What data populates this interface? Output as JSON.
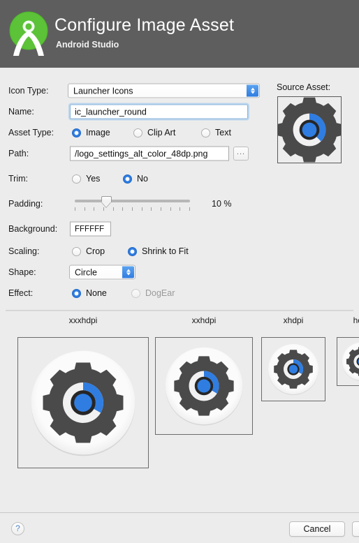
{
  "header": {
    "title": "Configure Image Asset",
    "subtitle": "Android Studio",
    "logo_icon": "android-studio-logo",
    "bg_color": "#5E5E5E"
  },
  "form": {
    "icon_type": {
      "label": "Icon Type:",
      "value": "Launcher Icons",
      "control": "combo-box"
    },
    "name": {
      "label": "Name:",
      "value": "ic_launcher_round",
      "focused": true
    },
    "asset_type": {
      "label": "Asset Type:",
      "options": [
        {
          "label": "Image",
          "selected": true,
          "disabled": false
        },
        {
          "label": "Clip Art",
          "selected": false,
          "disabled": false
        },
        {
          "label": "Text",
          "selected": false,
          "disabled": false
        }
      ]
    },
    "path": {
      "label": "Path:",
      "value": "/logo_settings_alt_color_48dp.png",
      "browse_label": "..."
    },
    "trim": {
      "label": "Trim:",
      "options": [
        {
          "label": "Yes",
          "selected": false,
          "disabled": false
        },
        {
          "label": "No",
          "selected": true,
          "disabled": false
        }
      ]
    },
    "padding": {
      "label": "Padding:",
      "value": 10,
      "value_text": "10 %",
      "min": -10,
      "max": 50,
      "tick_count": 13
    },
    "background": {
      "label": "Background:",
      "value": "FFFFFF"
    },
    "scaling": {
      "label": "Scaling:",
      "options": [
        {
          "label": "Crop",
          "selected": false,
          "disabled": false
        },
        {
          "label": "Shrink to Fit",
          "selected": true,
          "disabled": false
        }
      ]
    },
    "shape": {
      "label": "Shape:",
      "value": "Circle",
      "control": "combo-box"
    },
    "effect": {
      "label": "Effect:",
      "options": [
        {
          "label": "None",
          "selected": true,
          "disabled": false
        },
        {
          "label": "DogEar",
          "selected": false,
          "disabled": true
        }
      ]
    }
  },
  "source_asset": {
    "label": "Source Asset:",
    "icon": "gear-settings-icon"
  },
  "previews": [
    {
      "label": "xxxhdpi",
      "size": 188
    },
    {
      "label": "xxhdpi",
      "size": 140
    },
    {
      "label": "xhdpi",
      "size": 92
    },
    {
      "label": "hdpi",
      "size": 70
    }
  ],
  "footer": {
    "help_label": "?",
    "cancel_label": "Cancel"
  },
  "colors": {
    "accent_blue": "#2F7DE1",
    "gear_gray": "#4A4A4A",
    "icon_white": "#F1F1F1",
    "window_bg": "#ECECEC",
    "logo_green": "#5CC238"
  }
}
